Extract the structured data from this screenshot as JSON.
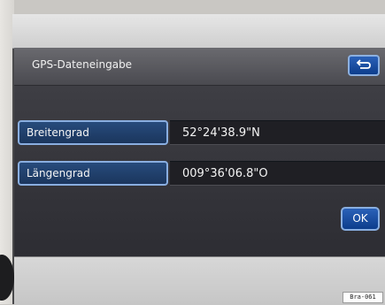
{
  "header": {
    "title": "GPS-Dateneingabe",
    "back_icon": "back-arrow-icon"
  },
  "fields": [
    {
      "label": "Breitengrad",
      "value": "52°24'38.9\"N"
    },
    {
      "label": "Längengrad",
      "value": "009°36'06.8\"O"
    }
  ],
  "ok_label": "OK",
  "footer": {
    "reference": "Bra-061"
  },
  "colors": {
    "button_blue": "#1b4ea3",
    "label_blue": "#274b7c",
    "value_bg": "#1f1f24",
    "title_bar": "#55555a"
  }
}
